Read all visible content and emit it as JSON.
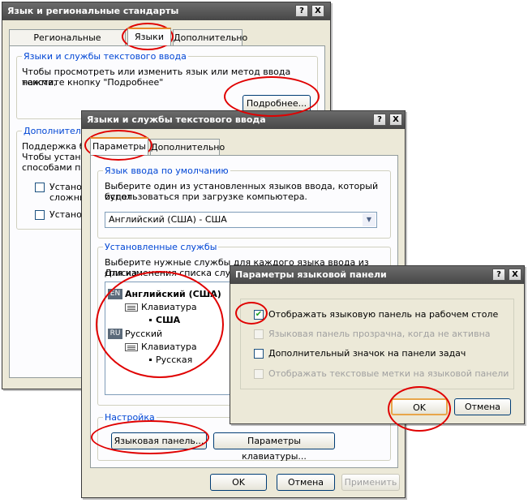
{
  "regional": {
    "title": "Язык и региональные стандарты",
    "help_btn": "?",
    "close_btn": "X",
    "tabs": [
      "Региональные параметры",
      "Языки",
      "Дополнительно"
    ],
    "group1_label": "Языки и службы текстового ввода",
    "group1_text1": "Чтобы просмотреть или изменить язык или метод ввода текста,",
    "group1_text2": "нажмите кнопку \"Подробнее\"",
    "details_button": "Подробнее...",
    "group2_label": "Дополнител",
    "group2_text1": "Поддержка б",
    "group2_text2": "Чтобы устано",
    "group2_text3": "способами п",
    "check1_text1": "Установ",
    "check1_text2": "сложны",
    "check2_text": "Установ"
  },
  "textsvc": {
    "title": "Языки и службы текстового ввода",
    "help_btn": "?",
    "close_btn": "X",
    "tabs": [
      "Параметры",
      "Дополнительно"
    ],
    "default_lang_label": "Язык ввода по умолчанию",
    "default_lang_text1": "Выберите один из установленных языков ввода, который будет",
    "default_lang_text2": "использоваться при загрузке компьютера.",
    "default_lang_value": "Английский (США) - США",
    "installed_label": "Установленные службы",
    "installed_text1": "Выберите нужные службы для каждого языка ввода из списка.",
    "installed_text2": "Для изменения списка служ",
    "tree": {
      "en_badge": "EN",
      "en_name": "Английский (США)",
      "en_kbd": "Клавиатура",
      "en_layout": "США",
      "ru_badge": "RU",
      "ru_name": "Русский",
      "ru_kbd": "Клавиатура",
      "ru_layout": "Русская"
    },
    "settings_label": "Настройка",
    "langbar_button": "Языковая панель...",
    "keyboard_button": "Параметры клавиатуры...",
    "ok": "OK",
    "cancel": "Отмена",
    "apply": "Применить"
  },
  "langbar": {
    "title": "Параметры языковой панели",
    "help_btn": "?",
    "close_btn": "X",
    "opt1": "Отображать языковую панель на рабочем столе",
    "opt2": "Языковая панель прозрачна, когда не активна",
    "opt3": "Дополнительный значок на панели задач",
    "opt4": "Отображать текстовые метки на языковой панели",
    "ok": "OK",
    "cancel": "Отмена"
  },
  "colors": {
    "highlight": "#e00000",
    "group_label": "#0046d5",
    "titlebar": "#5a5a5a"
  }
}
